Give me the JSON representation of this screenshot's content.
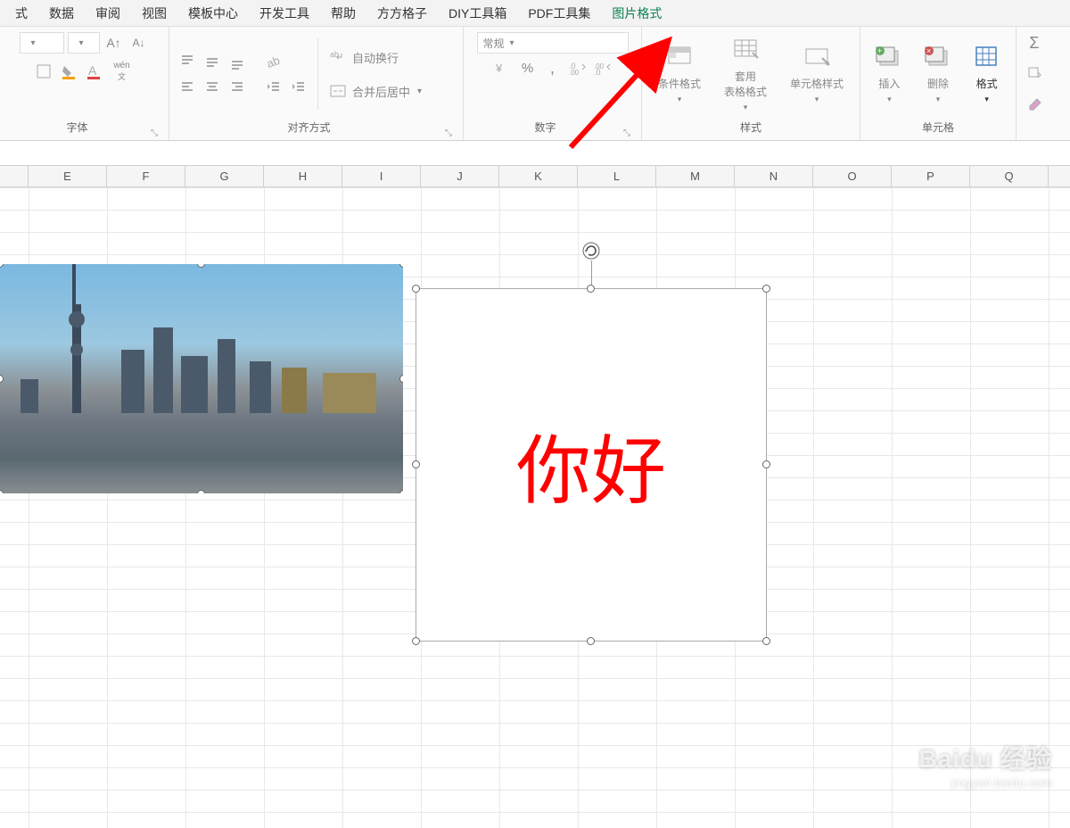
{
  "menu": {
    "items": [
      "式",
      "数据",
      "审阅",
      "视图",
      "模板中心",
      "开发工具",
      "帮助",
      "方方格子",
      "DIY工具箱",
      "PDF工具集",
      "图片格式"
    ],
    "active_index": 10
  },
  "ribbon": {
    "font_group": "字体",
    "wen": "wén",
    "wen_sub": "文",
    "align_group": "对齐方式",
    "wrap": "自动换行",
    "merge": "合并后居中",
    "number_group": "数字",
    "number_format": "常规",
    "styles_group": "样式",
    "cond_fmt": "条件格式",
    "table_fmt": "套用\n表格格式",
    "cell_style": "单元格样式",
    "cells_group": "单元格",
    "insert": "插入",
    "delete": "删除",
    "format": "格式"
  },
  "columns": [
    "",
    "E",
    "F",
    "G",
    "H",
    "I",
    "J",
    "K",
    "L",
    "M",
    "N",
    "O",
    "P",
    "Q"
  ],
  "textbox": {
    "content": "你好"
  },
  "watermark": {
    "line1": "Baidu 经验",
    "line2": "jingyan.baidu.com"
  }
}
